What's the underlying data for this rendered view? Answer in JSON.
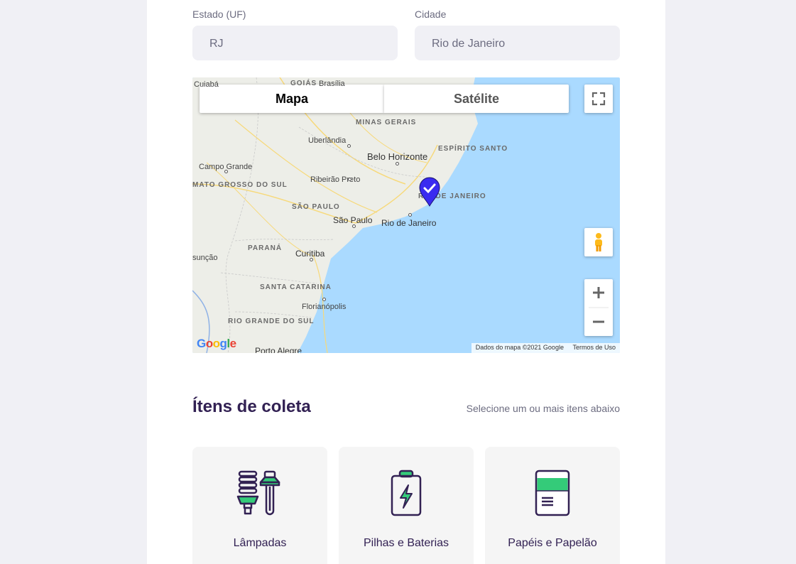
{
  "form": {
    "uf": {
      "label": "Estado (UF)",
      "value": "RJ"
    },
    "city": {
      "label": "Cidade",
      "value": "Rio de Janeiro"
    }
  },
  "map": {
    "tabs": {
      "map": "Mapa",
      "satellite": "Satélite"
    },
    "labels": {
      "cuiaba": "Cuiabá",
      "goias": "GOIÁS",
      "brasilia": "Brasília",
      "minas": "MINAS GERAIS",
      "uberlandia": "Uberlândia",
      "espirito": "ESPÍRITO SANTO",
      "campo_grande": "Campo Grande",
      "bh": "Belo Horizonte",
      "ribeirao": "Ribeirão Preto",
      "ms": "MATO GROSSO DO SUL",
      "sp_state": "SÃO PAULO",
      "rj_state": "RIO DE JANEIRO",
      "sp_city": "São Paulo",
      "rj_city": "Rio de Janeiro",
      "parana": "PARANÁ",
      "curitiba": "Curitiba",
      "assuncao": "sunção",
      "sc": "SANTA CATARINA",
      "floripa": "Florianópolis",
      "rs": "RIO GRANDE DO SUL",
      "poa": "Porto Alegre"
    },
    "attribution": "Dados do mapa ©2021 Google",
    "terms": "Termos de Uso",
    "google": "Google"
  },
  "items_section": {
    "title": "Ítens de coleta",
    "hint": "Selecione um ou mais itens abaixo",
    "items": [
      {
        "label": "Lâmpadas"
      },
      {
        "label": "Pilhas e Baterias"
      },
      {
        "label": "Papéis e Papelão"
      }
    ]
  },
  "colors": {
    "accent": "#34CB79",
    "title": "#322153",
    "text": "#6C6C80",
    "marker": "#3A2BF0"
  }
}
